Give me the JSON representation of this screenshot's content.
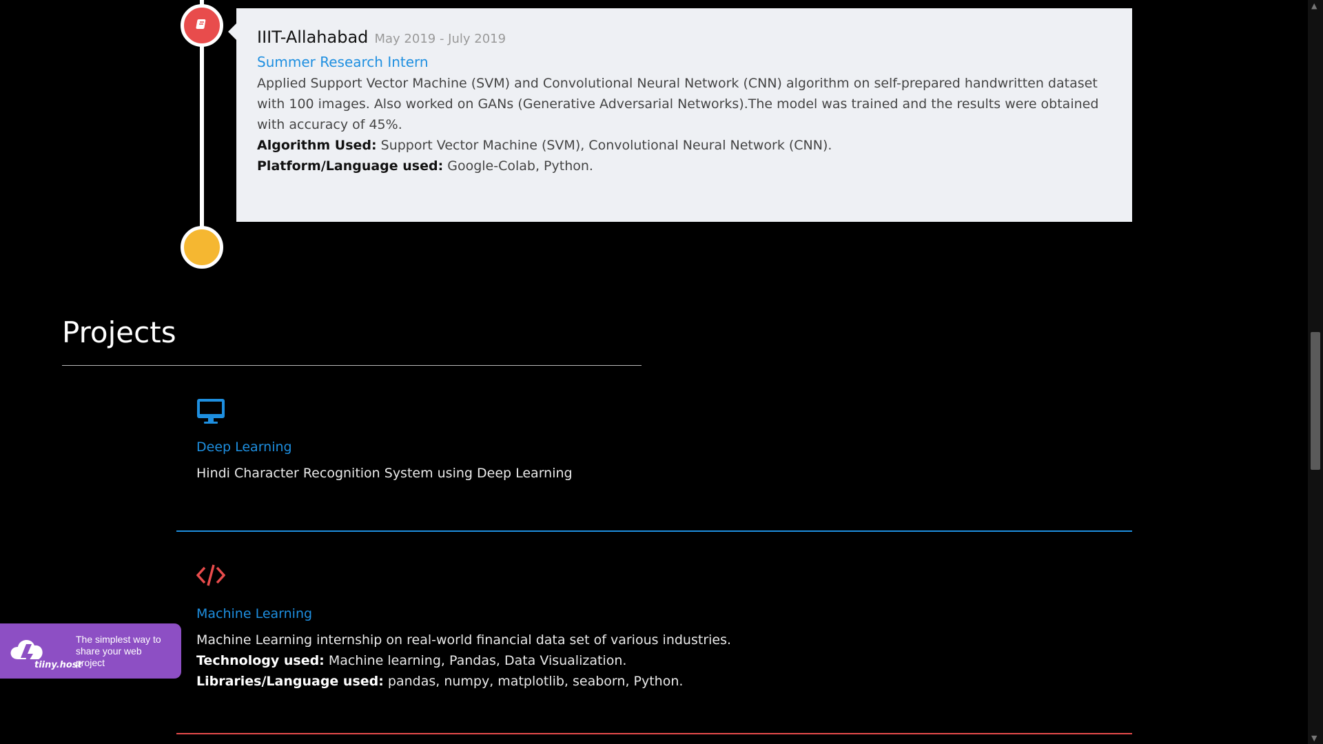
{
  "experience": {
    "org": "IIIT-Allahabad",
    "dates": "May 2019 - July 2019",
    "role": "Summer Research Intern",
    "description": "Applied Support Vector Machine (SVM) and Convolutional Neural Network (CNN) algorithm on self-prepared handwritten dataset with 100 images. Also worked on GANs (Generative Adversarial Networks).The model was trained and the results were obtained with accuracy of 45%.",
    "algo_label": "Algorithm Used:",
    "algo_value": " Support Vector Machine (SVM), Convolutional Neural Network (CNN).",
    "platform_label": "Platform/Language used:",
    "platform_value": " Google-Colab, Python."
  },
  "projects": {
    "title": "Projects",
    "items": [
      {
        "icon": "desktop-icon",
        "title": "Deep Learning",
        "description": "Hindi Character Recognition System using Deep Learning",
        "color": "#1e8fe0"
      },
      {
        "icon": "code-icon",
        "title": "Machine Learning",
        "description": "Machine Learning internship on real-world financial data set of various industries.",
        "tech_label": "Technology used:",
        "tech_value": " Machine learning, Pandas, Data Visualization.",
        "lib_label": "Libraries/Language used:",
        "lib_value": " pandas, numpy, matplotlib, seaborn, Python.",
        "color": "#e84c4c"
      }
    ]
  },
  "badge": {
    "brand": "tiiny.host",
    "text": "The simplest way to share your web project"
  },
  "colors": {
    "accent_blue": "#1e8fe0",
    "accent_red": "#e84c4c",
    "accent_yellow": "#f5b731",
    "badge_purple": "#8d4fc4"
  }
}
